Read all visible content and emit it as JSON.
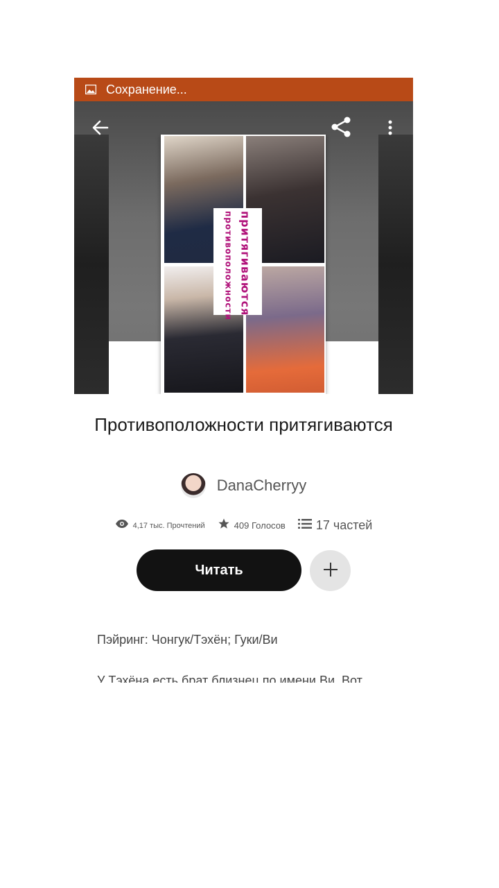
{
  "notification": {
    "text": "Сохранение...",
    "icon": "image-icon",
    "color": "#b84a17"
  },
  "toolbar": {
    "back_icon": "arrow-left-icon",
    "share_icon": "share-icon",
    "more_icon": "more-vert-icon"
  },
  "cover": {
    "title_line1": "противоположности",
    "title_line2": "притягиваются"
  },
  "book": {
    "title": "Противоположности притягиваются",
    "author": "DanaCherryy"
  },
  "stats": {
    "reads": "4,17 тыс. Прочтений",
    "votes": "409 Голосов",
    "parts": "17 частей"
  },
  "actions": {
    "read_label": "Читать",
    "add_icon": "plus-icon"
  },
  "description": {
    "pairing": "Пэйринг: Чонгук/Тэхён; Гуки/Ви",
    "text": "У Тэхёна есть брат близнец по имени Ви. Вот"
  }
}
